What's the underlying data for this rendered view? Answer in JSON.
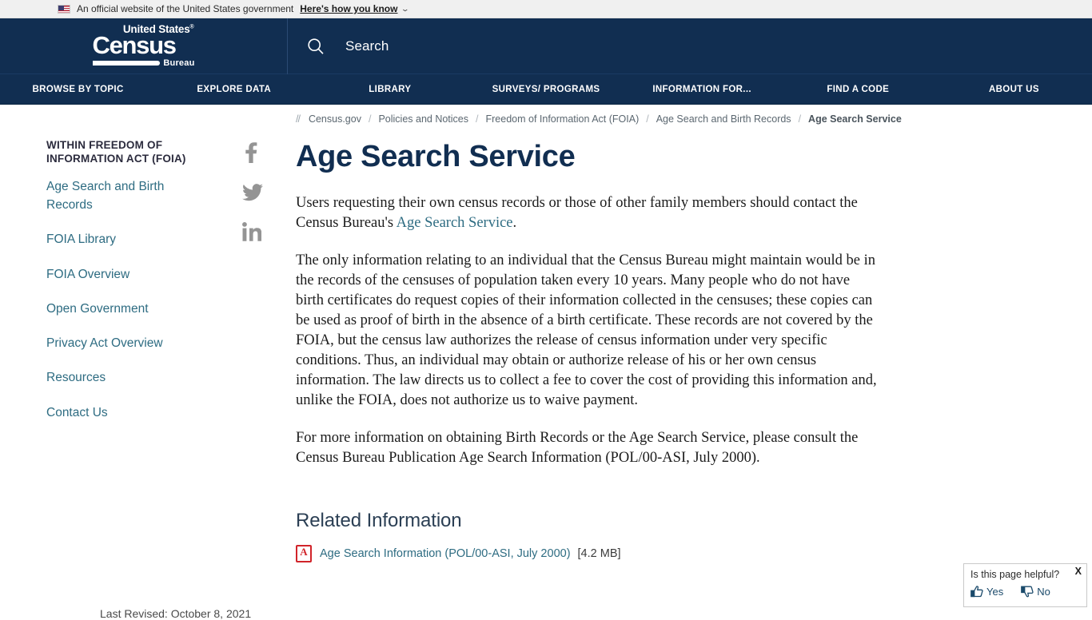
{
  "banner": {
    "flag_icon": "us-flag-icon",
    "text": "An official website of the United States government",
    "link": "Here's how you know",
    "chevron_icon": "chevron-down-icon"
  },
  "masthead": {
    "logo": {
      "line1": "United States",
      "registered": "®",
      "line2": "Census",
      "line3": "Bureau"
    },
    "search": {
      "icon": "search-icon",
      "placeholder": "Search",
      "value": ""
    }
  },
  "mainnav": {
    "items": [
      {
        "label": "BROWSE BY TOPIC"
      },
      {
        "label": "EXPLORE DATA"
      },
      {
        "label": "LIBRARY"
      },
      {
        "label": "SURVEYS/ PROGRAMS"
      },
      {
        "label": "INFORMATION FOR..."
      },
      {
        "label": "FIND A CODE"
      },
      {
        "label": "ABOUT US"
      }
    ]
  },
  "breadcrumb": {
    "prefix": "//",
    "items": [
      {
        "label": "Census.gov"
      },
      {
        "label": "Policies and Notices"
      },
      {
        "label": "Freedom of Information Act (FOIA)"
      },
      {
        "label": "Age Search and Birth Records"
      }
    ],
    "separator": "/",
    "current": "Age Search Service"
  },
  "sidebar": {
    "title": "Within Freedom of Information Act (FOIA)",
    "items": [
      {
        "label": "Age Search and Birth Records"
      },
      {
        "label": "FOIA Library"
      },
      {
        "label": "FOIA Overview"
      },
      {
        "label": "Open Government"
      },
      {
        "label": "Privacy Act Overview"
      },
      {
        "label": "Resources"
      },
      {
        "label": "Contact Us"
      }
    ],
    "social": [
      {
        "name": "facebook-icon",
        "glyph": "f"
      },
      {
        "name": "twitter-icon",
        "glyph": "twitter"
      },
      {
        "name": "linkedin-icon",
        "glyph": "in"
      }
    ]
  },
  "main": {
    "title": "Age Search Service",
    "paragraph1_before": "Users requesting their own census records or those of other family members should contact the Census Bureau's ",
    "paragraph1_link": "Age Search Service",
    "paragraph1_after": ".",
    "paragraph2": "The only information relating to an individual that the Census Bureau might maintain would be in the records of the censuses of population taken every 10 years.  Many people who do not have birth certificates do request copies of their information collected in the censuses; these copies can be used as proof of birth in the absence of a birth certificate. These records are not covered by the FOIA, but the census law authorizes the release of census information under very specific conditions. Thus, an individual may obtain or authorize release of his or her own census information. The law directs us to collect a fee to cover the cost of providing this information and, unlike the FOIA, does not authorize us to waive payment.",
    "paragraph3": "For more information on obtaining Birth Records or the Age Search Service, please consult the Census Bureau Publication Age Search Information (POL/00-ASI, July 2000).",
    "related_title": "Related Information",
    "related": {
      "icon": "pdf-icon",
      "link": "Age Search Information (POL/00-ASI, July 2000)",
      "size": "[4.2 MB]"
    }
  },
  "footer": {
    "last_revised": "Last Revised: October 8, 2021"
  },
  "feedback": {
    "question": "Is this page helpful?",
    "close": "X",
    "yes": "Yes",
    "no": "No",
    "thumbs_up_icon": "thumbs-up-icon",
    "thumbs_down_icon": "thumbs-down-icon"
  },
  "colors": {
    "navy": "#112e51",
    "link_teal": "#2e6c82",
    "banner_bg": "#f0f0f0",
    "pdf_red": "#d1242a"
  }
}
